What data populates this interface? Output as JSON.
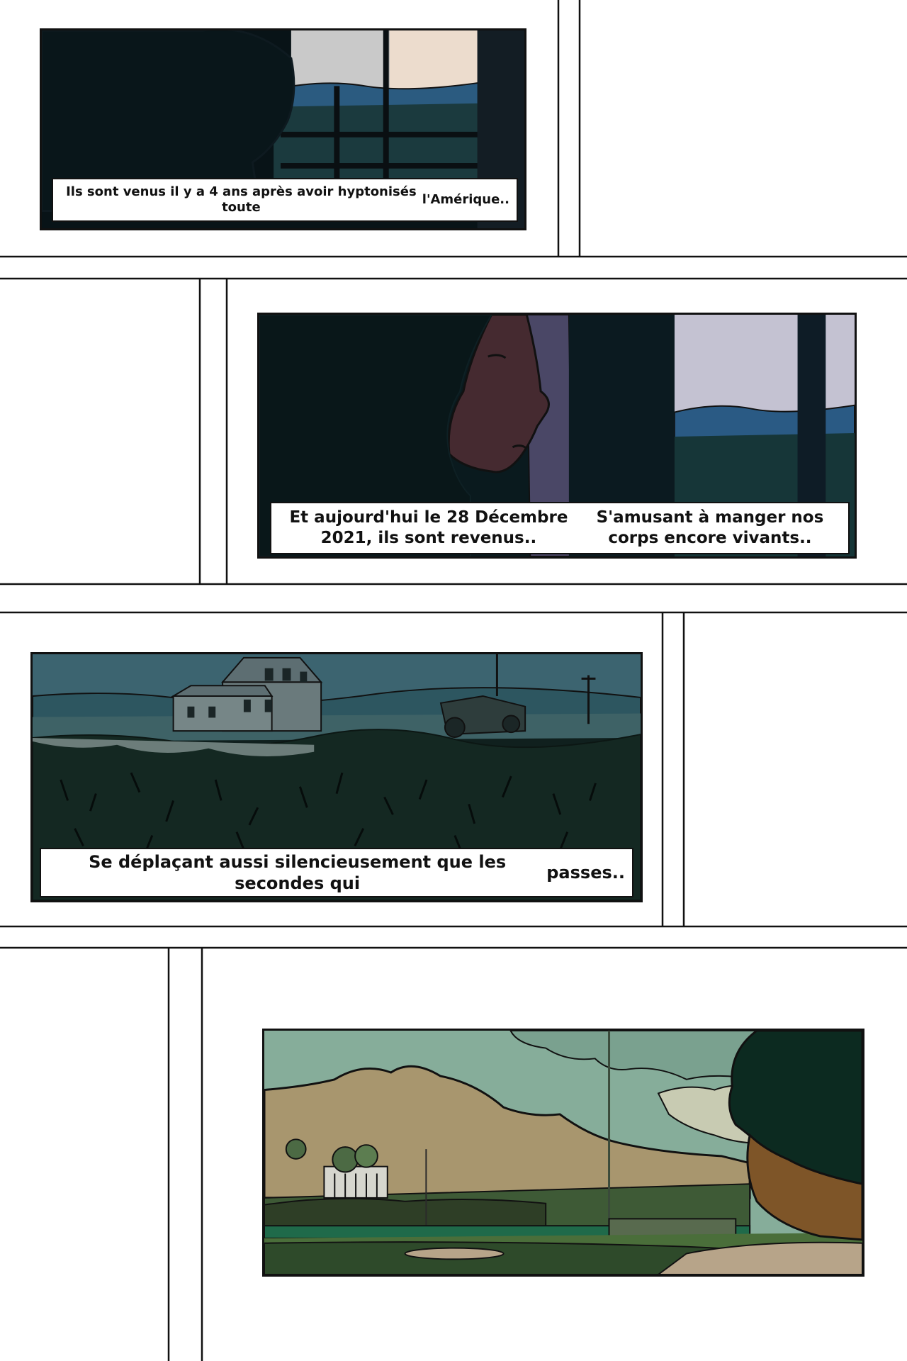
{
  "panels": [
    {
      "id": "panel-1",
      "caption": [
        "Ils sont venus il y a 4 ans après avoir hyptonisés toute",
        "l'Amérique.."
      ]
    },
    {
      "id": "panel-2",
      "caption": [
        "Et aujourd'hui le 28 Décembre 2021, ils sont revenus..",
        "S'amusant à manger nos corps encore vivants.."
      ]
    },
    {
      "id": "panel-3",
      "caption": [
        "Se déplaçant aussi silencieusement que les secondes qui",
        "passes.."
      ]
    },
    {
      "id": "panel-4",
      "caption": []
    }
  ],
  "colors": {
    "ink": "#111111",
    "night": "#0b1418",
    "hills": "#2a5a7e",
    "sky_dusk": "#c8c6d6",
    "field_sky": "#86ad9a",
    "mountain": "#a8966e"
  }
}
